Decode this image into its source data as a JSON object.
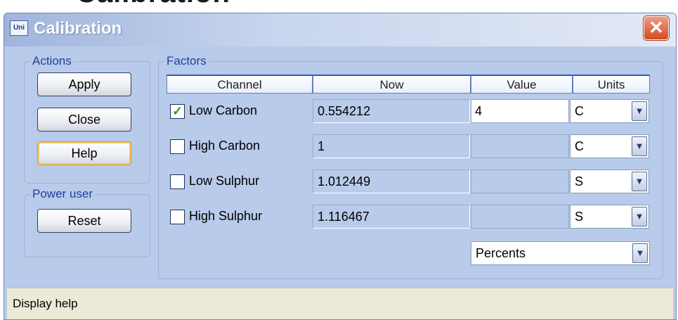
{
  "window": {
    "title": "Calibration",
    "app_icon": "Uni",
    "close_glyph": "✕"
  },
  "actions": {
    "legend": "Actions",
    "apply_label": "Apply",
    "close_label": "Close",
    "help_label": "Help"
  },
  "power_user": {
    "legend": "Power user",
    "reset_label": "Reset"
  },
  "factors": {
    "legend": "Factors",
    "headers": {
      "channel": "Channel",
      "now": "Now",
      "value": "Value",
      "units": "Units"
    },
    "rows": [
      {
        "channel": "Low Carbon",
        "checked": true,
        "check_glyph": "✓",
        "now": "0.554212",
        "value": "4",
        "unit": "C"
      },
      {
        "channel": "High Carbon",
        "checked": false,
        "check_glyph": "",
        "now": "1",
        "value": "",
        "unit": "C"
      },
      {
        "channel": "Low Sulphur",
        "checked": false,
        "check_glyph": "",
        "now": "1.012449",
        "value": "",
        "unit": "S"
      },
      {
        "channel": "High Sulphur",
        "checked": false,
        "check_glyph": "",
        "now": "1.116467",
        "value": "",
        "unit": "S"
      }
    ],
    "mode_select": "Percents"
  },
  "statusbar": {
    "text": "Display help"
  },
  "icons": {
    "dropdown_arrow": "chevron-down-icon",
    "close": "close-icon",
    "check": "check-icon"
  },
  "colors": {
    "client_bg": "#b9cbea",
    "legend_text": "#1f3f9e",
    "close_red": "#d24a22",
    "check_green": "#2a9a2a"
  }
}
